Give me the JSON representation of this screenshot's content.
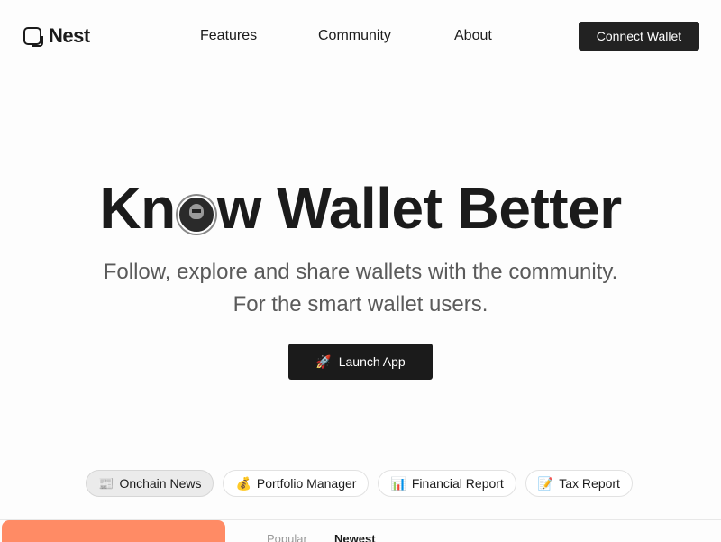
{
  "brand": {
    "name": "Nest"
  },
  "nav": {
    "items": [
      "Features",
      "Community",
      "About"
    ]
  },
  "header": {
    "connect_label": "Connect Wallet"
  },
  "hero": {
    "title_before": "Kn",
    "title_after": "w Wallet Better",
    "subtitle_line1": "Follow, explore and share wallets with the community.",
    "subtitle_line2": "For the smart wallet users.",
    "launch_icon": "🚀",
    "launch_label": "Launch App"
  },
  "pills": [
    {
      "icon": "📰",
      "label": "Onchain News",
      "active": true
    },
    {
      "icon": "💰",
      "label": "Portfolio Manager",
      "active": false
    },
    {
      "icon": "📊",
      "label": "Financial Report",
      "active": false
    },
    {
      "icon": "📝",
      "label": "Tax Report",
      "active": false
    }
  ],
  "preview": {
    "tabs": [
      "Popular",
      "Newest"
    ]
  },
  "colors": {
    "accent": "#ff8b65",
    "dark": "#1b1b1b",
    "muted": "#5a5a5a"
  }
}
